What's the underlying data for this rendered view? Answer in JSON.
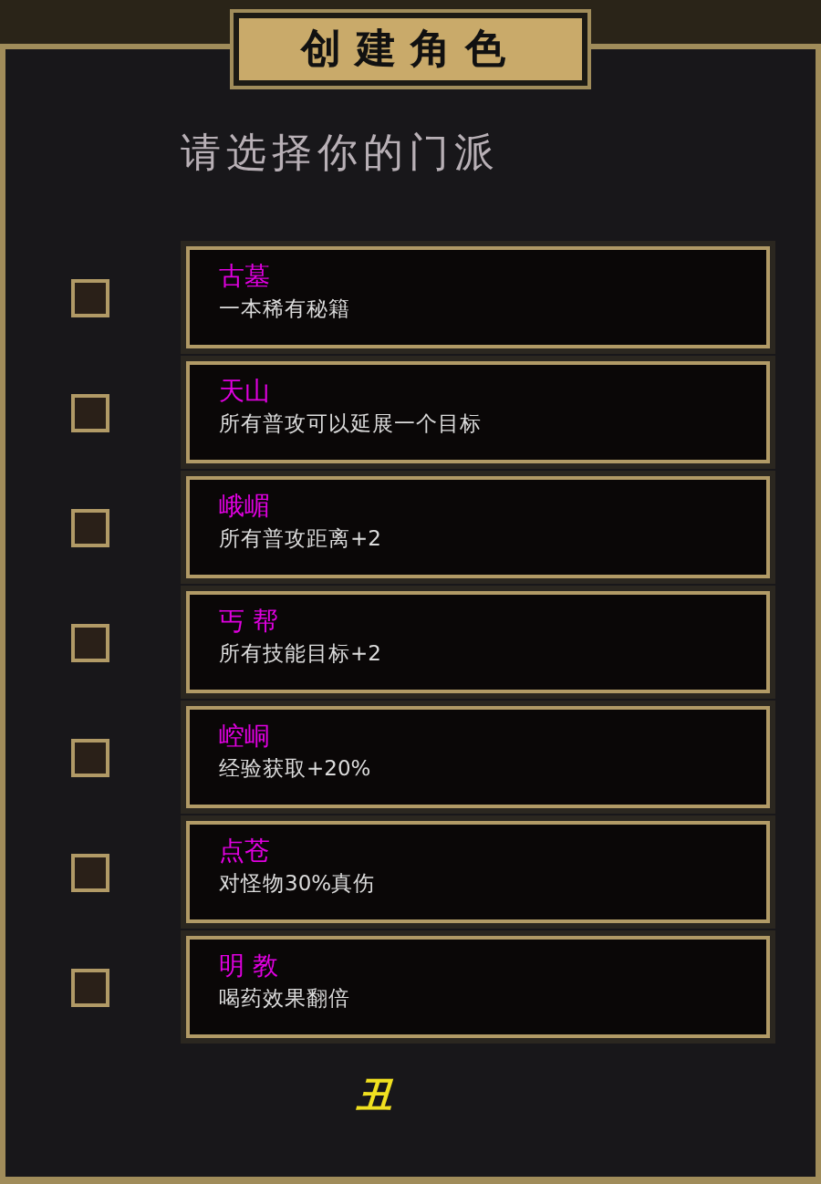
{
  "title": "创建角色",
  "prompt": "请选择你的门派",
  "sects": [
    {
      "name": "古墓",
      "desc": "一本稀有秘籍",
      "checked": false
    },
    {
      "name": "天山",
      "desc": "所有普攻可以延展一个目标",
      "checked": false
    },
    {
      "name": "峨嵋",
      "desc": "所有普攻距离+2",
      "checked": false
    },
    {
      "name": "丐 帮",
      "desc": "所有技能目标+2",
      "checked": false
    },
    {
      "name": "崆峒",
      "desc": "经验获取+20%",
      "checked": false
    },
    {
      "name": "点苍",
      "desc": "对怪物30%真伤",
      "checked": false
    },
    {
      "name": "明 教",
      "desc": "喝药效果翻倍",
      "checked": false
    }
  ],
  "footer": "丑"
}
